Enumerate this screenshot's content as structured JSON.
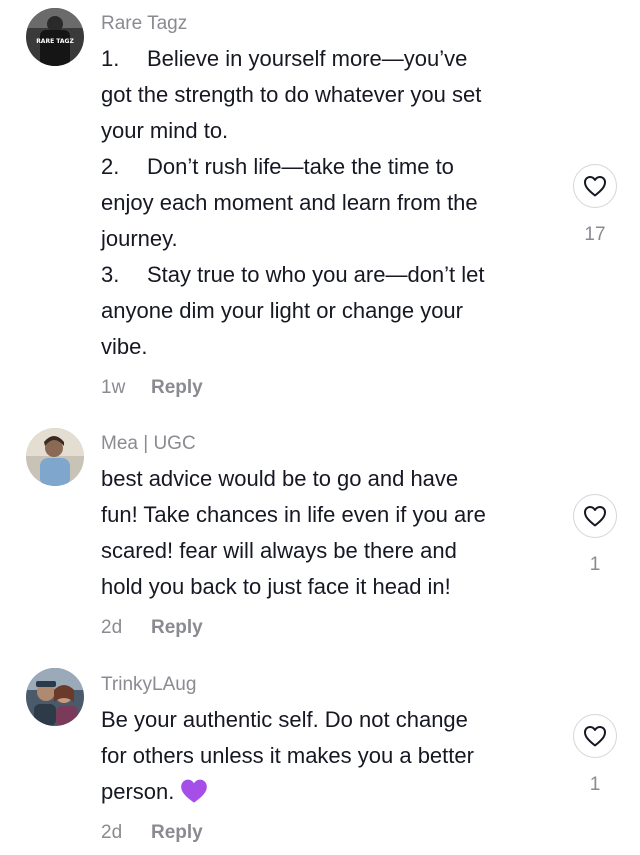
{
  "comments": [
    {
      "username": "Rare Tagz",
      "avatar_text": "RARE TAGZ",
      "lines": [
        {
          "num": "1.",
          "text": "Believe in yourself more—you’ve"
        },
        {
          "num": "",
          "text": "got the strength to do whatever you set"
        },
        {
          "num": "",
          "text": "your mind to."
        },
        {
          "num": "2.",
          "text": "Don’t rush life—take the time to"
        },
        {
          "num": "",
          "text": "enjoy each moment and learn from the"
        },
        {
          "num": "",
          "text": "journey."
        },
        {
          "num": "3.",
          "text": "Stay true to who you are—don’t let"
        },
        {
          "num": "",
          "text": "anyone dim your light or change your"
        },
        {
          "num": "",
          "text": "vibe."
        }
      ],
      "time": "1w",
      "reply_label": "Reply",
      "like_count": "17"
    },
    {
      "username": "Mea | UGC",
      "lines": [
        {
          "text": "best advice would be to go and have"
        },
        {
          "text": "fun! Take chances in life even if you are"
        },
        {
          "text": "scared! fear will always be there and"
        },
        {
          "text": "hold you back to just face it head in!"
        }
      ],
      "time": "2d",
      "reply_label": "Reply",
      "like_count": "1"
    },
    {
      "username": "TrinkyLAug",
      "lines": [
        {
          "text": "Be your authentic self. Do not change"
        },
        {
          "text": "for others unless it makes you a better"
        },
        {
          "text": "person."
        }
      ],
      "emoji": "purple-heart",
      "time": "2d",
      "reply_label": "Reply",
      "like_count": "1"
    }
  ],
  "icons": {
    "like": "heart-outline-icon",
    "emoji": "purple-heart-emoji"
  },
  "colors": {
    "text": "#161823",
    "secondary": "#8a8b91",
    "purple_heart": "#a64ee8"
  }
}
